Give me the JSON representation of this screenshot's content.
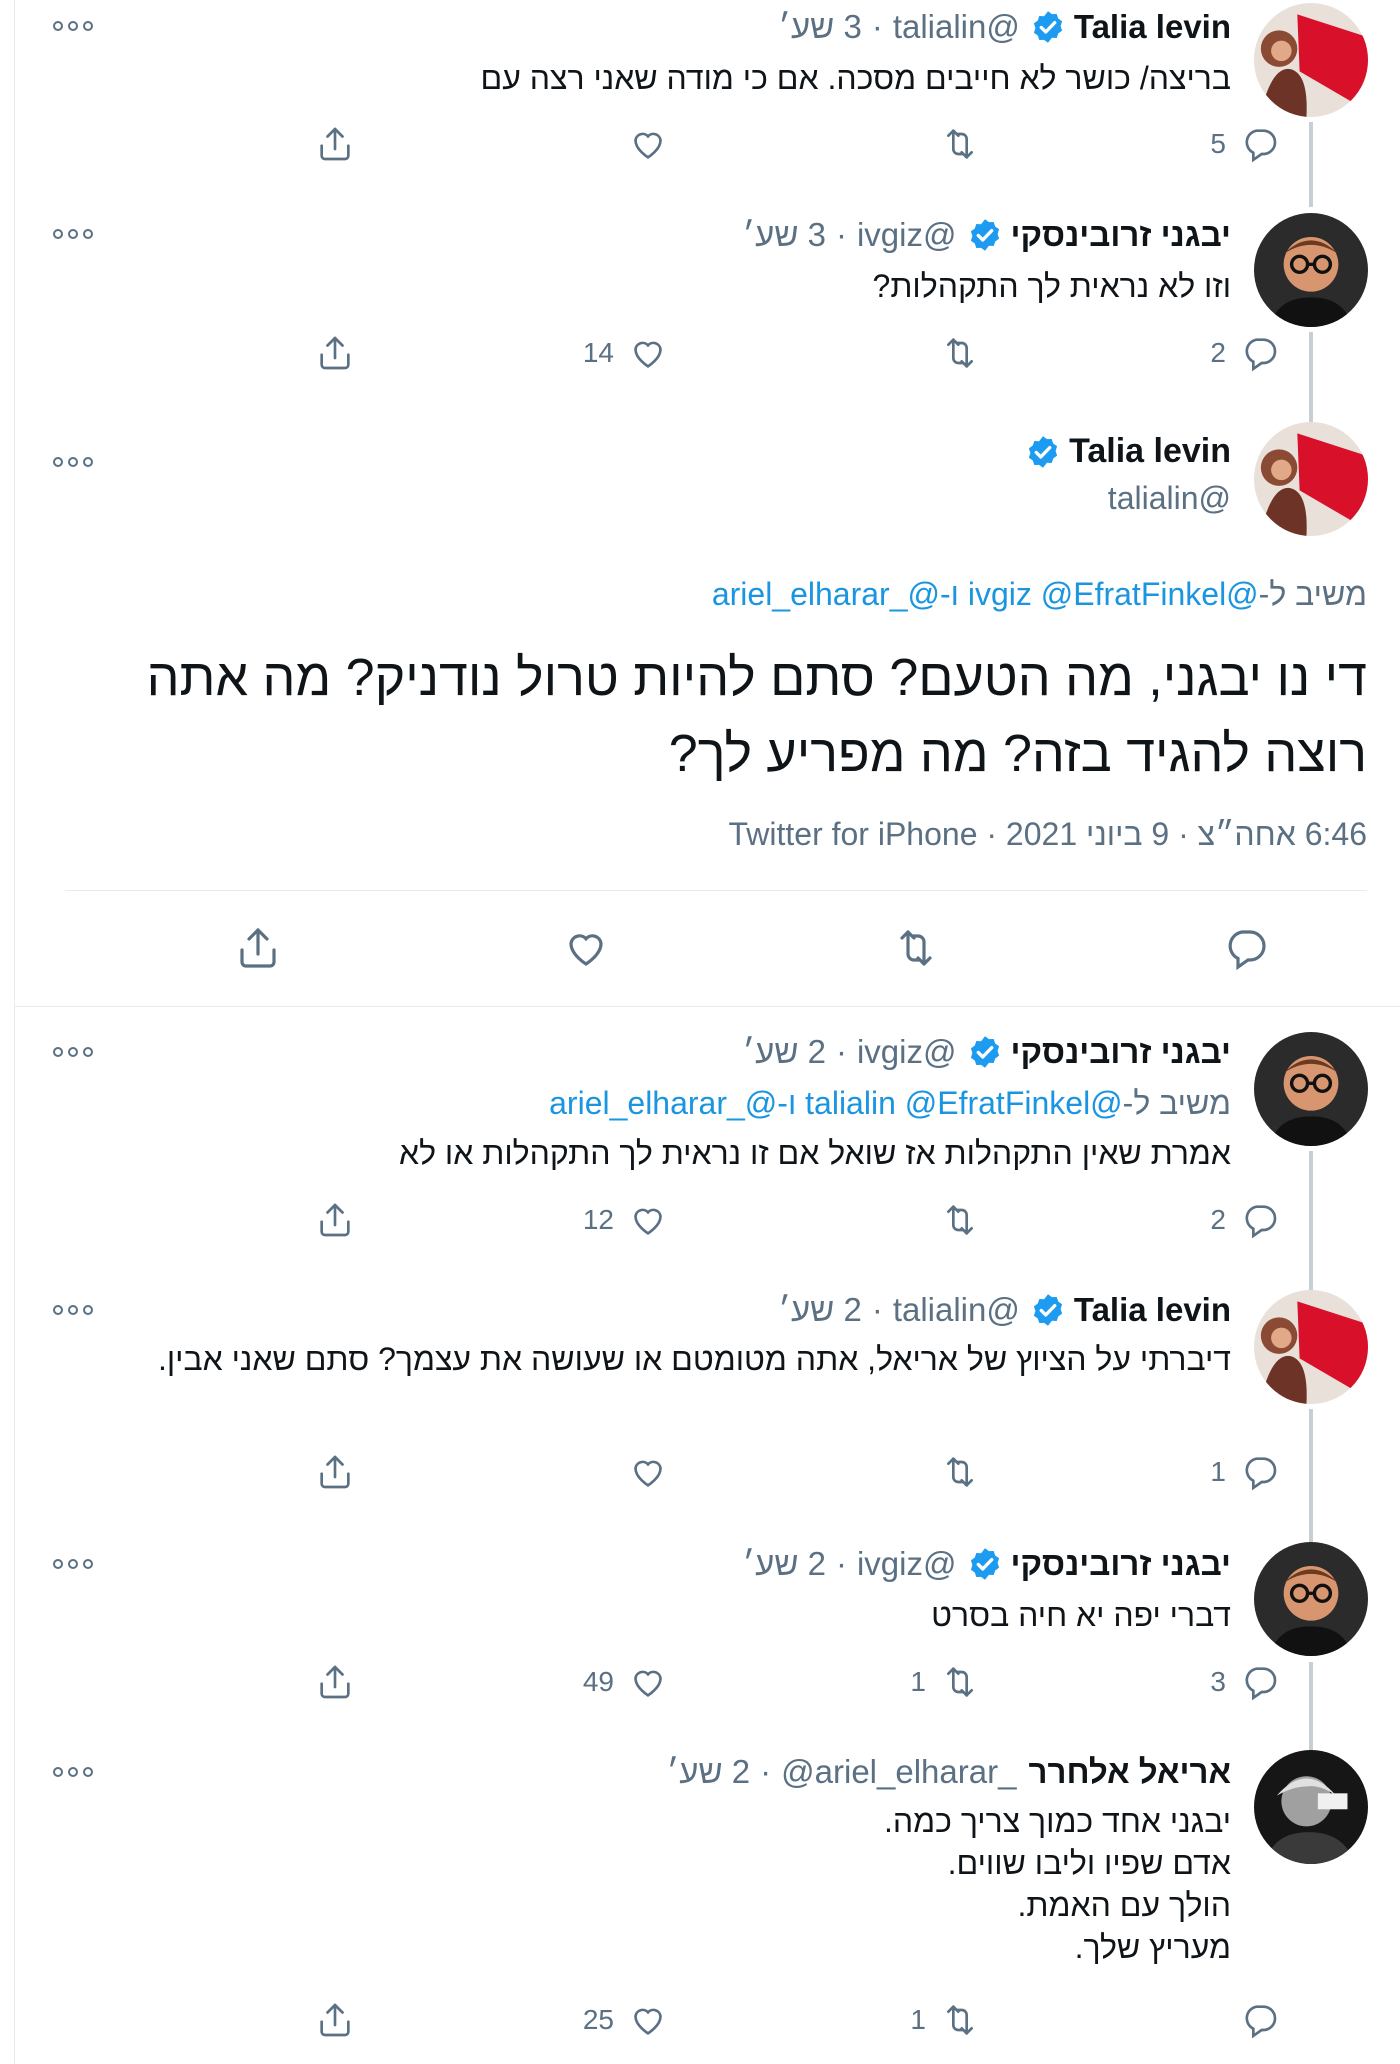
{
  "tweets": {
    "t1": {
      "name": "Talia levin",
      "handle": "@talialin",
      "time": "3 שע׳",
      "text": "בריצה/ כושר לא חייבים מסכה. אם כי מודה שאני רצה עם",
      "replies": "5",
      "retweets": "",
      "likes": ""
    },
    "t2": {
      "name": "יבגני זרובינסקי",
      "handle": "@ivgiz",
      "time": "3 שע׳",
      "text": "וזו לא נראית לך התקהלות?",
      "replies": "2",
      "retweets": "",
      "likes": "14"
    },
    "focus": {
      "name": "Talia levin",
      "handle": "@talialin",
      "reply_prefix": "משיב ל-",
      "reply_mentions": "@ivgiz @EfratFinkel ו-@_ariel_elharar",
      "text": "די נו יבגני, מה הטעם? סתם להיות טרול נודניק? מה אתה רוצה להגיד בזה? מה מפריע לך?",
      "meta": "6:46 אחה״צ · 9 ביוני 2021 · Twitter for iPhone"
    },
    "t3": {
      "name": "יבגני זרובינסקי",
      "handle": "@ivgiz",
      "time": "2 שע׳",
      "reply_prefix": "משיב ל-",
      "reply_mentions": "@talialin @EfratFinkel ו-@_ariel_elharar",
      "text": "אמרת שאין התקהלות אז שואל אם זו נראית לך התקהלות או לא",
      "replies": "2",
      "retweets": "",
      "likes": "12"
    },
    "t4": {
      "name": "Talia levin",
      "handle": "@talialin",
      "time": "2 שע׳",
      "text": "דיברתי על הציוץ של אריאל, אתה מטומטם או שעושה את עצמך? סתם שאני אבין.",
      "replies": "1",
      "retweets": "",
      "likes": ""
    },
    "t5": {
      "name": "יבגני זרובינסקי",
      "handle": "@ivgiz",
      "time": "2 שע׳",
      "text": "דברי יפה יא חיה בסרט",
      "replies": "3",
      "retweets": "1",
      "likes": "49"
    },
    "t6": {
      "name": "אריאל אלחרר",
      "handle": "@ariel_elharar_",
      "time": "2 שע׳",
      "lines": [
        "יבגני אחד כמוך צריך כמה.",
        "אדם שפיו וליבו שווים.",
        "הולך עם האמת.",
        "מעריץ שלך."
      ],
      "replies": "",
      "retweets": "1",
      "likes": "25"
    }
  },
  "colors": {
    "text": "#0f1419",
    "secondary": "#5b7083",
    "link": "#1b95e0",
    "verified": "#1d9bf0",
    "thread_line": "#c4cfd6"
  },
  "icons": [
    "reply-icon",
    "retweet-icon",
    "like-icon",
    "share-icon",
    "more-icon",
    "verified-icon"
  ]
}
